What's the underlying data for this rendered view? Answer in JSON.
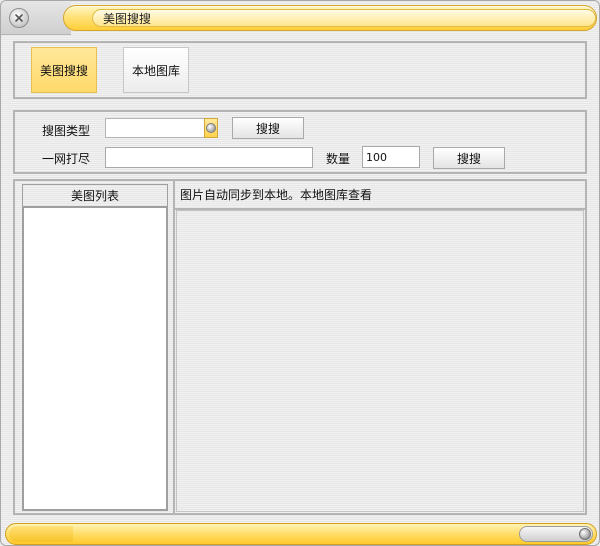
{
  "window": {
    "title": "美图搜搜"
  },
  "tabs": [
    {
      "label": "美图搜搜",
      "active": true
    },
    {
      "label": "本地图库",
      "active": false
    }
  ],
  "search": {
    "type_label": "搜图类型",
    "type_value": "",
    "search_button_1": "搜搜",
    "bulk_label": "一网打尽",
    "bulk_value": "",
    "count_label": "数量",
    "count_value": "100",
    "search_button_2": "搜搜"
  },
  "list": {
    "header": "美图列表"
  },
  "info": {
    "message": "图片自动同步到本地。本地图库查看"
  },
  "colors": {
    "accent": "#ffd96a",
    "border": "#b4b4b4"
  }
}
